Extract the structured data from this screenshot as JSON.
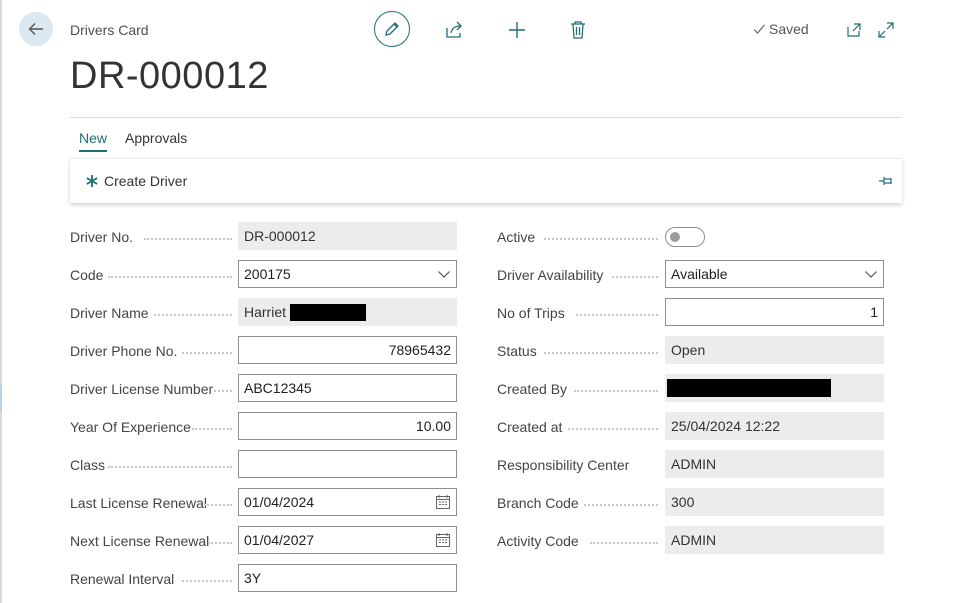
{
  "header": {
    "breadcrumb": "Drivers Card",
    "title": "DR-000012",
    "saved_label": "Saved"
  },
  "icons": {
    "back": "arrow-left-icon",
    "edit": "pencil-icon",
    "share": "share-icon",
    "new": "plus-icon",
    "delete": "trash-icon",
    "saved": "checkmark-icon",
    "popout": "open-in-new-window-icon",
    "expand": "expand-icon",
    "create": "asterisk-icon",
    "pin": "pin-icon",
    "chevron": "chevron-down-icon",
    "calendar": "calendar-icon"
  },
  "colors": {
    "accent": "#1f6e74",
    "back_button_bg": "#dbe8ef",
    "readonly_bg": "#ececec"
  },
  "tabs": [
    {
      "label": "New",
      "active": true
    },
    {
      "label": "Approvals",
      "active": false
    }
  ],
  "actions": {
    "create_driver": "Create Driver"
  },
  "form": {
    "left": [
      {
        "label": "Driver No.",
        "value": "DR-000012"
      },
      {
        "label": "Code",
        "value": "200175"
      },
      {
        "label": "Driver Name",
        "value": "Harriet"
      },
      {
        "label": "Driver Phone No.",
        "value": "78965432"
      },
      {
        "label": "Driver License Number",
        "value": "ABC12345"
      },
      {
        "label": "Year Of Experience",
        "value": "10.00"
      },
      {
        "label": "Class",
        "value": ""
      },
      {
        "label": "Last License Renewal",
        "value": "01/04/2024"
      },
      {
        "label": "Next License Renewal",
        "value": "01/04/2027"
      },
      {
        "label": "Renewal Interval",
        "value": "3Y"
      }
    ],
    "right": [
      {
        "label": "Active",
        "value": false
      },
      {
        "label": "Driver Availability",
        "value": "Available"
      },
      {
        "label": "No of Trips",
        "value": "1"
      },
      {
        "label": "Status",
        "value": "Open"
      },
      {
        "label": "Created By",
        "value": ""
      },
      {
        "label": "Created at",
        "value": "25/04/2024 12:22"
      },
      {
        "label": "Responsibility Center",
        "value": "ADMIN"
      },
      {
        "label": "Branch Code",
        "value": "300"
      },
      {
        "label": "Activity Code",
        "value": "ADMIN"
      }
    ]
  }
}
